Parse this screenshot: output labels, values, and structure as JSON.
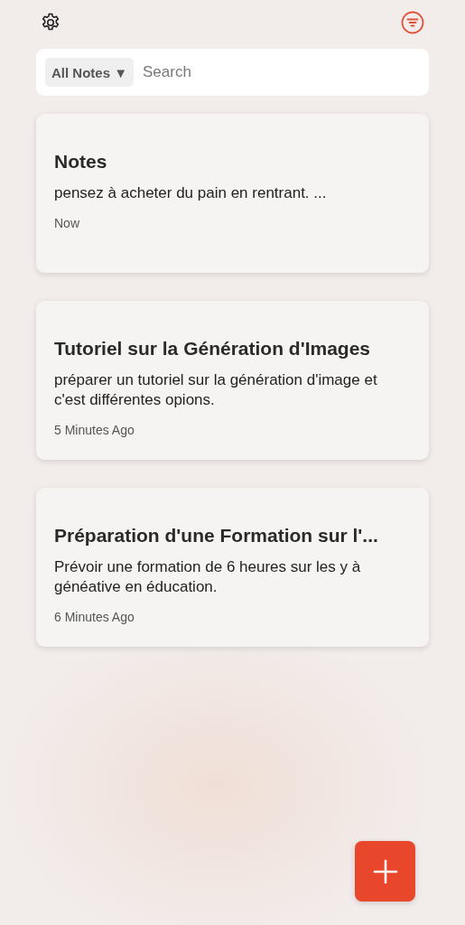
{
  "filter": {
    "label": "All Notes ▼"
  },
  "search": {
    "placeholder": "Search"
  },
  "notes": [
    {
      "title": "Notes",
      "body": "pensez à acheter du pain en rentrant. ...",
      "time": "Now"
    },
    {
      "title": "Tutoriel sur la Génération d'Images",
      "body": "préparer un tutoriel sur la génération d'image et c'est différentes opions.",
      "time": "5 Minutes Ago"
    },
    {
      "title": "Préparation d'une Formation sur l'...",
      "body": "Prévoir une formation de 6 heures sur les y à généative en éducation.",
      "time": "6 Minutes Ago"
    }
  ]
}
